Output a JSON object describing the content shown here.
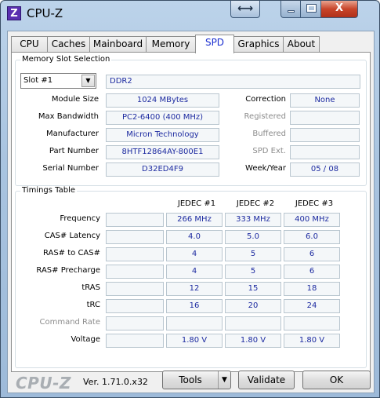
{
  "window": {
    "title": "CPU-Z",
    "app_icon_letter": "Z",
    "resize_glyph": "⟷",
    "close_glyph": "X"
  },
  "tabs": [
    {
      "label": "CPU"
    },
    {
      "label": "Caches"
    },
    {
      "label": "Mainboard"
    },
    {
      "label": "Memory"
    },
    {
      "label": "SPD"
    },
    {
      "label": "Graphics"
    },
    {
      "label": "About"
    }
  ],
  "active_tab": "SPD",
  "slot": {
    "group_title": "Memory Slot Selection",
    "selected": "Slot #1",
    "type": "DDR2",
    "module_size_label": "Module Size",
    "module_size": "1024 MBytes",
    "max_bandwidth_label": "Max Bandwidth",
    "max_bandwidth": "PC2-6400 (400 MHz)",
    "manufacturer_label": "Manufacturer",
    "manufacturer": "Micron Technology",
    "part_number_label": "Part Number",
    "part_number": "8HTF12864AY-800E1",
    "serial_number_label": "Serial Number",
    "serial_number": "D32ED4F9",
    "correction_label": "Correction",
    "correction": "None",
    "registered_label": "Registered",
    "registered": "",
    "buffered_label": "Buffered",
    "buffered": "",
    "spd_ext_label": "SPD Ext.",
    "spd_ext": "",
    "week_year_label": "Week/Year",
    "week_year": "05 / 08"
  },
  "timings": {
    "group_title": "Timings Table",
    "columns": [
      "JEDEC #1",
      "JEDEC #2",
      "JEDEC #3"
    ],
    "rows": [
      {
        "label": "Frequency",
        "values": [
          "266 MHz",
          "333 MHz",
          "400 MHz"
        ]
      },
      {
        "label": "CAS# Latency",
        "values": [
          "4.0",
          "5.0",
          "6.0"
        ]
      },
      {
        "label": "RAS# to CAS#",
        "values": [
          "4",
          "5",
          "6"
        ]
      },
      {
        "label": "RAS# Precharge",
        "values": [
          "4",
          "5",
          "6"
        ]
      },
      {
        "label": "tRAS",
        "values": [
          "12",
          "15",
          "18"
        ]
      },
      {
        "label": "tRC",
        "values": [
          "16",
          "20",
          "24"
        ]
      },
      {
        "label": "Command Rate",
        "values": [
          "",
          "",
          ""
        ]
      },
      {
        "label": "Voltage",
        "values": [
          "1.80 V",
          "1.80 V",
          "1.80 V"
        ]
      }
    ]
  },
  "footer": {
    "logo": "CPU-Z",
    "version": "Ver. 1.71.0.x32",
    "tools_label": "Tools",
    "validate_label": "Validate",
    "ok_label": "OK"
  }
}
